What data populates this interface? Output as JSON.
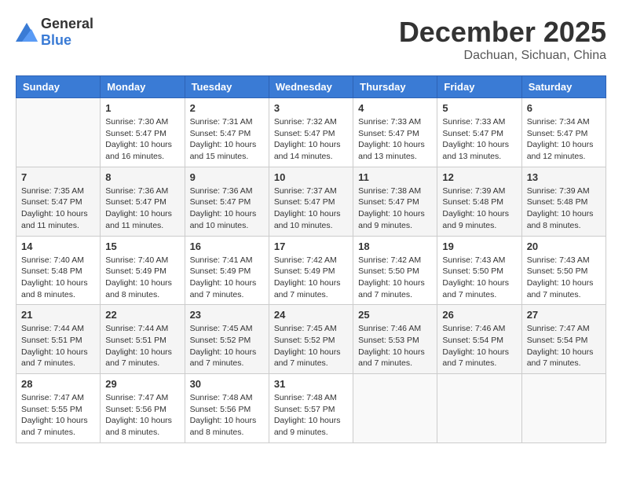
{
  "header": {
    "logo_general": "General",
    "logo_blue": "Blue",
    "month_year": "December 2025",
    "location": "Dachuan, Sichuan, China"
  },
  "weekdays": [
    "Sunday",
    "Monday",
    "Tuesday",
    "Wednesday",
    "Thursday",
    "Friday",
    "Saturday"
  ],
  "weeks": [
    [
      {
        "day": "",
        "empty": true
      },
      {
        "day": "1",
        "sunrise": "7:30 AM",
        "sunset": "5:47 PM",
        "daylight": "10 hours and 16 minutes."
      },
      {
        "day": "2",
        "sunrise": "7:31 AM",
        "sunset": "5:47 PM",
        "daylight": "10 hours and 15 minutes."
      },
      {
        "day": "3",
        "sunrise": "7:32 AM",
        "sunset": "5:47 PM",
        "daylight": "10 hours and 14 minutes."
      },
      {
        "day": "4",
        "sunrise": "7:33 AM",
        "sunset": "5:47 PM",
        "daylight": "10 hours and 13 minutes."
      },
      {
        "day": "5",
        "sunrise": "7:33 AM",
        "sunset": "5:47 PM",
        "daylight": "10 hours and 13 minutes."
      },
      {
        "day": "6",
        "sunrise": "7:34 AM",
        "sunset": "5:47 PM",
        "daylight": "10 hours and 12 minutes."
      }
    ],
    [
      {
        "day": "7",
        "sunrise": "7:35 AM",
        "sunset": "5:47 PM",
        "daylight": "10 hours and 11 minutes."
      },
      {
        "day": "8",
        "sunrise": "7:36 AM",
        "sunset": "5:47 PM",
        "daylight": "10 hours and 11 minutes."
      },
      {
        "day": "9",
        "sunrise": "7:36 AM",
        "sunset": "5:47 PM",
        "daylight": "10 hours and 10 minutes."
      },
      {
        "day": "10",
        "sunrise": "7:37 AM",
        "sunset": "5:47 PM",
        "daylight": "10 hours and 10 minutes."
      },
      {
        "day": "11",
        "sunrise": "7:38 AM",
        "sunset": "5:47 PM",
        "daylight": "10 hours and 9 minutes."
      },
      {
        "day": "12",
        "sunrise": "7:39 AM",
        "sunset": "5:48 PM",
        "daylight": "10 hours and 9 minutes."
      },
      {
        "day": "13",
        "sunrise": "7:39 AM",
        "sunset": "5:48 PM",
        "daylight": "10 hours and 8 minutes."
      }
    ],
    [
      {
        "day": "14",
        "sunrise": "7:40 AM",
        "sunset": "5:48 PM",
        "daylight": "10 hours and 8 minutes."
      },
      {
        "day": "15",
        "sunrise": "7:40 AM",
        "sunset": "5:49 PM",
        "daylight": "10 hours and 8 minutes."
      },
      {
        "day": "16",
        "sunrise": "7:41 AM",
        "sunset": "5:49 PM",
        "daylight": "10 hours and 7 minutes."
      },
      {
        "day": "17",
        "sunrise": "7:42 AM",
        "sunset": "5:49 PM",
        "daylight": "10 hours and 7 minutes."
      },
      {
        "day": "18",
        "sunrise": "7:42 AM",
        "sunset": "5:50 PM",
        "daylight": "10 hours and 7 minutes."
      },
      {
        "day": "19",
        "sunrise": "7:43 AM",
        "sunset": "5:50 PM",
        "daylight": "10 hours and 7 minutes."
      },
      {
        "day": "20",
        "sunrise": "7:43 AM",
        "sunset": "5:50 PM",
        "daylight": "10 hours and 7 minutes."
      }
    ],
    [
      {
        "day": "21",
        "sunrise": "7:44 AM",
        "sunset": "5:51 PM",
        "daylight": "10 hours and 7 minutes."
      },
      {
        "day": "22",
        "sunrise": "7:44 AM",
        "sunset": "5:51 PM",
        "daylight": "10 hours and 7 minutes."
      },
      {
        "day": "23",
        "sunrise": "7:45 AM",
        "sunset": "5:52 PM",
        "daylight": "10 hours and 7 minutes."
      },
      {
        "day": "24",
        "sunrise": "7:45 AM",
        "sunset": "5:52 PM",
        "daylight": "10 hours and 7 minutes."
      },
      {
        "day": "25",
        "sunrise": "7:46 AM",
        "sunset": "5:53 PM",
        "daylight": "10 hours and 7 minutes."
      },
      {
        "day": "26",
        "sunrise": "7:46 AM",
        "sunset": "5:54 PM",
        "daylight": "10 hours and 7 minutes."
      },
      {
        "day": "27",
        "sunrise": "7:47 AM",
        "sunset": "5:54 PM",
        "daylight": "10 hours and 7 minutes."
      }
    ],
    [
      {
        "day": "28",
        "sunrise": "7:47 AM",
        "sunset": "5:55 PM",
        "daylight": "10 hours and 7 minutes."
      },
      {
        "day": "29",
        "sunrise": "7:47 AM",
        "sunset": "5:56 PM",
        "daylight": "10 hours and 8 minutes."
      },
      {
        "day": "30",
        "sunrise": "7:48 AM",
        "sunset": "5:56 PM",
        "daylight": "10 hours and 8 minutes."
      },
      {
        "day": "31",
        "sunrise": "7:48 AM",
        "sunset": "5:57 PM",
        "daylight": "10 hours and 9 minutes."
      },
      {
        "day": "",
        "empty": true
      },
      {
        "day": "",
        "empty": true
      },
      {
        "day": "",
        "empty": true
      }
    ]
  ]
}
